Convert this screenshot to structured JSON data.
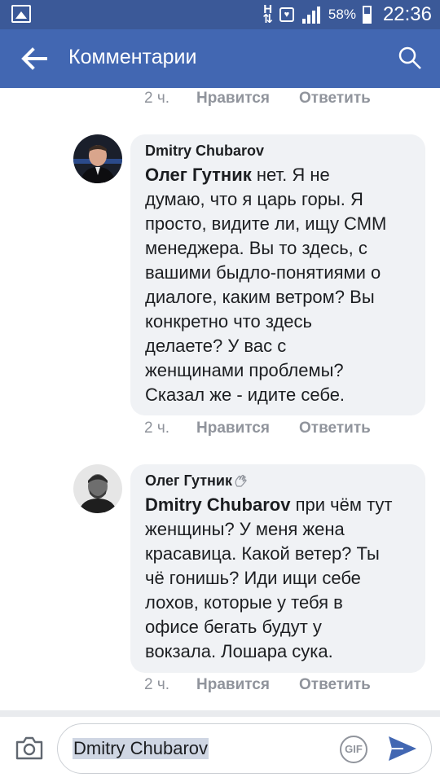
{
  "status_bar": {
    "battery": "58%",
    "time": "22:36"
  },
  "header": {
    "title": "Комментарии",
    "icons": [
      "back-arrow-icon",
      "search-icon"
    ]
  },
  "comments": [
    {
      "meta": {
        "time": "2 ч.",
        "like": "Нравится",
        "reply": "Ответить"
      }
    },
    {
      "author": "Dmitry Chubarov",
      "mention": "Олег Гутник",
      "text_lines": [
        " нет. Я не",
        "думаю, что я царь горы. Я",
        "просто, видите ли, ищу СММ",
        "менеджера. Вы то здесь, с",
        "вашими быдло-понятиями о",
        "диалоге, каким ветром? Вы",
        "конкретно что здесь",
        "делаете? У вас с",
        "женщинами проблемы?",
        "Сказал же - идите себе."
      ],
      "meta": {
        "time": "2 ч.",
        "like": "Нравится",
        "reply": "Ответить"
      }
    },
    {
      "author": "Олег Гутник",
      "author_icon": "waving-hand-icon",
      "mention": "Dmitry Chubarov",
      "text_lines": [
        " при чём тут",
        "женщины? У меня жена",
        "красавица. Какой ветер? Ты",
        "чё гонишь? Иди ищи себе",
        "лохов, которые у тебя в",
        "офисе бегать будут у",
        "вокзала. Лошара сука."
      ],
      "meta": {
        "time": "2 ч.",
        "like": "Нравится",
        "reply": "Ответить"
      }
    }
  ],
  "composer": {
    "value": "Dmitry Chubarov",
    "gif_label": "GIF",
    "icons": [
      "camera-icon",
      "gif-icon",
      "send-icon"
    ]
  },
  "colors": {
    "status_bar": "#3b5998",
    "app_bar": "#4267b2",
    "bubble": "#f0f2f5",
    "meta_text": "#90949c",
    "send": "#4267b2"
  }
}
